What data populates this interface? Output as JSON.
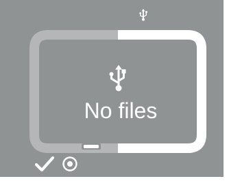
{
  "screen": {
    "background_color": "#8f9394",
    "status_bar": {
      "usb_icon": "usb-icon"
    },
    "device_frame": {
      "dim_color": "#b4b6b7",
      "highlight_color": "#ffffff",
      "usb_icon": "usb-icon"
    },
    "message": "No files",
    "footer": {
      "confirm_icon": "check-icon",
      "select_icon": "radio-target-icon"
    }
  }
}
